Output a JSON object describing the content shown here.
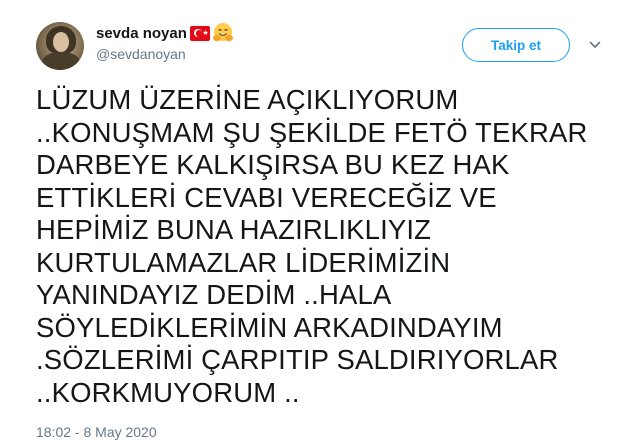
{
  "author": {
    "display_name": "sevda noyan",
    "emoji_icons": [
      "turkish-flag-icon",
      "hugging-face-icon"
    ],
    "username": "@sevdanoyan"
  },
  "actions": {
    "follow_label": "Takip et",
    "menu_icon": "chevron-down-icon"
  },
  "tweet": {
    "lines": [
      "LÜZUM ÜZERİNE AÇIKLIYORUM",
      "..KONUŞMAM ŞU ŞEKİLDE FETÖ TEKRAR",
      "DARBEYE KALKIŞIRSA BU KEZ HAK",
      "ETTİKLERİ CEVABI VERECEĞİZ VE",
      "HEPİMİZ BUNA HAZIRLIKLIYIZ",
      "KURTULAMAZLAR LİDERİMİZİN",
      "YANINDAYIZ DEDİM ..HALA",
      "SÖYLEDİKLERİMİN ARKADINDAYIM",
      ".SÖZLERİMİ ÇARPITIP SALDIRIYORLAR",
      "..KORKMUYORUM .."
    ],
    "timestamp": "18:02 - 8 May 2020"
  },
  "colors": {
    "accent": "#1da1f2",
    "text": "#14171a",
    "secondary": "#657786",
    "flag_red": "#e30a17"
  }
}
